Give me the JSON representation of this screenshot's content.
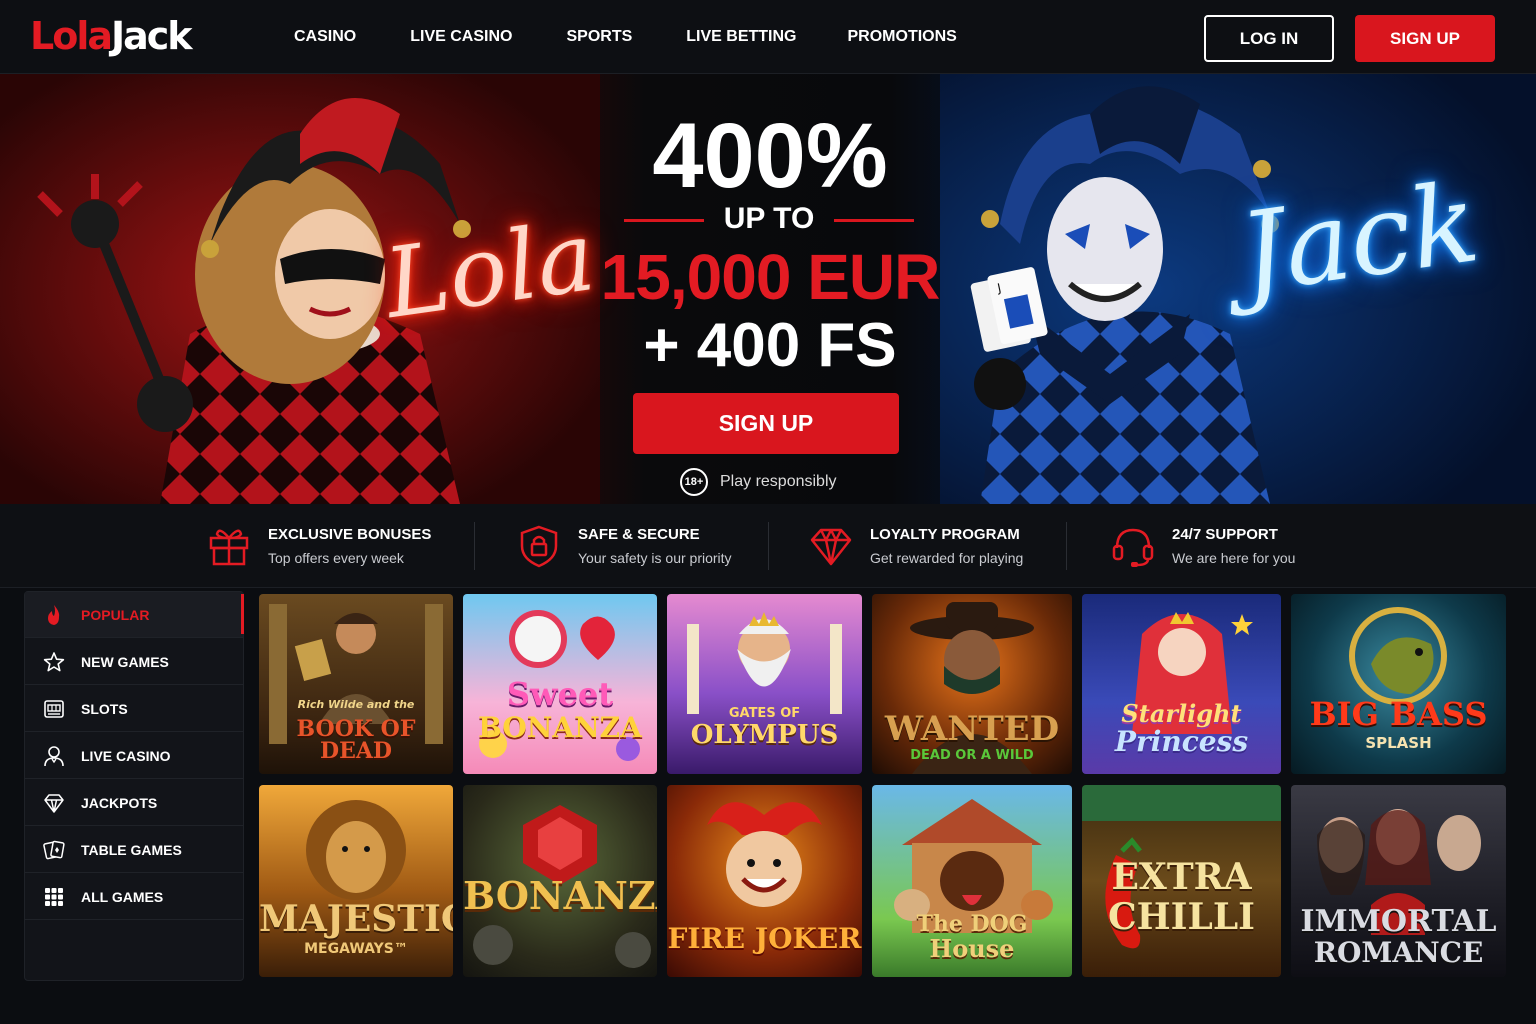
{
  "header": {
    "logo_part1": "Lola",
    "logo_part2": "Jack",
    "nav": [
      "CASINO",
      "LIVE CASINO",
      "SPORTS",
      "LIVE BETTING",
      "PROMOTIONS"
    ],
    "login_label": "LOG IN",
    "signup_label": "SIGN UP"
  },
  "hero": {
    "neon_left": "Lola",
    "neon_right": "Jack",
    "percent": "400%",
    "up_to": "UP TO",
    "amount": "15,000 EUR",
    "free_spins": "+ 400 FS",
    "cta_label": "SIGN UP",
    "age_badge": "18+",
    "responsible_text": "Play responsibly"
  },
  "features": [
    {
      "icon": "gift-icon",
      "title": "EXCLUSIVE BONUSES",
      "subtitle": "Top offers every week"
    },
    {
      "icon": "shield-lock-icon",
      "title": "SAFE & SECURE",
      "subtitle": "Your safety is our priority"
    },
    {
      "icon": "diamond-icon",
      "title": "LOYALTY PROGRAM",
      "subtitle": "Get rewarded for playing"
    },
    {
      "icon": "headset-icon",
      "title": "24/7 SUPPORT",
      "subtitle": "We are here for you"
    }
  ],
  "sidebar": {
    "items": [
      {
        "icon": "fire-icon",
        "label": "POPULAR",
        "active": true
      },
      {
        "icon": "star-icon",
        "label": "NEW GAMES",
        "active": false
      },
      {
        "icon": "slot-machine-icon",
        "label": "SLOTS",
        "active": false
      },
      {
        "icon": "dealer-icon",
        "label": "LIVE CASINO",
        "active": false
      },
      {
        "icon": "diamond-icon",
        "label": "JACKPOTS",
        "active": false
      },
      {
        "icon": "cards-icon",
        "label": "TABLE GAMES",
        "active": false
      },
      {
        "icon": "grid-icon",
        "label": "ALL GAMES",
        "active": false
      }
    ]
  },
  "games": [
    {
      "title": "BOOK OF DEAD",
      "subtitle": "Rich Wilde and the"
    },
    {
      "title": "Sweet",
      "subtitle": "BONANZA"
    },
    {
      "title": "OLYMPUS",
      "subtitle": "GATES OF"
    },
    {
      "title": "WANTED",
      "subtitle": "DEAD OR A WILD"
    },
    {
      "title": "Starlight",
      "subtitle": "Princess"
    },
    {
      "title": "BIG BASS",
      "subtitle": "SPLASH"
    },
    {
      "title": "MAJESTIC",
      "subtitle": "MEGAWAYS™"
    },
    {
      "title": "BONANZA",
      "subtitle": ""
    },
    {
      "title": "FIRE JOKER",
      "subtitle": ""
    },
    {
      "title": "The DOG",
      "subtitle": "House"
    },
    {
      "title": "EXTRA",
      "subtitle": "CHILLI"
    },
    {
      "title": "IMMORTAL",
      "subtitle": "ROMANCE"
    }
  ],
  "colors": {
    "accent_red": "#d9161e",
    "background": "#0b0d11",
    "neon_red": "#ff2a10",
    "neon_blue": "#1a8cff"
  }
}
